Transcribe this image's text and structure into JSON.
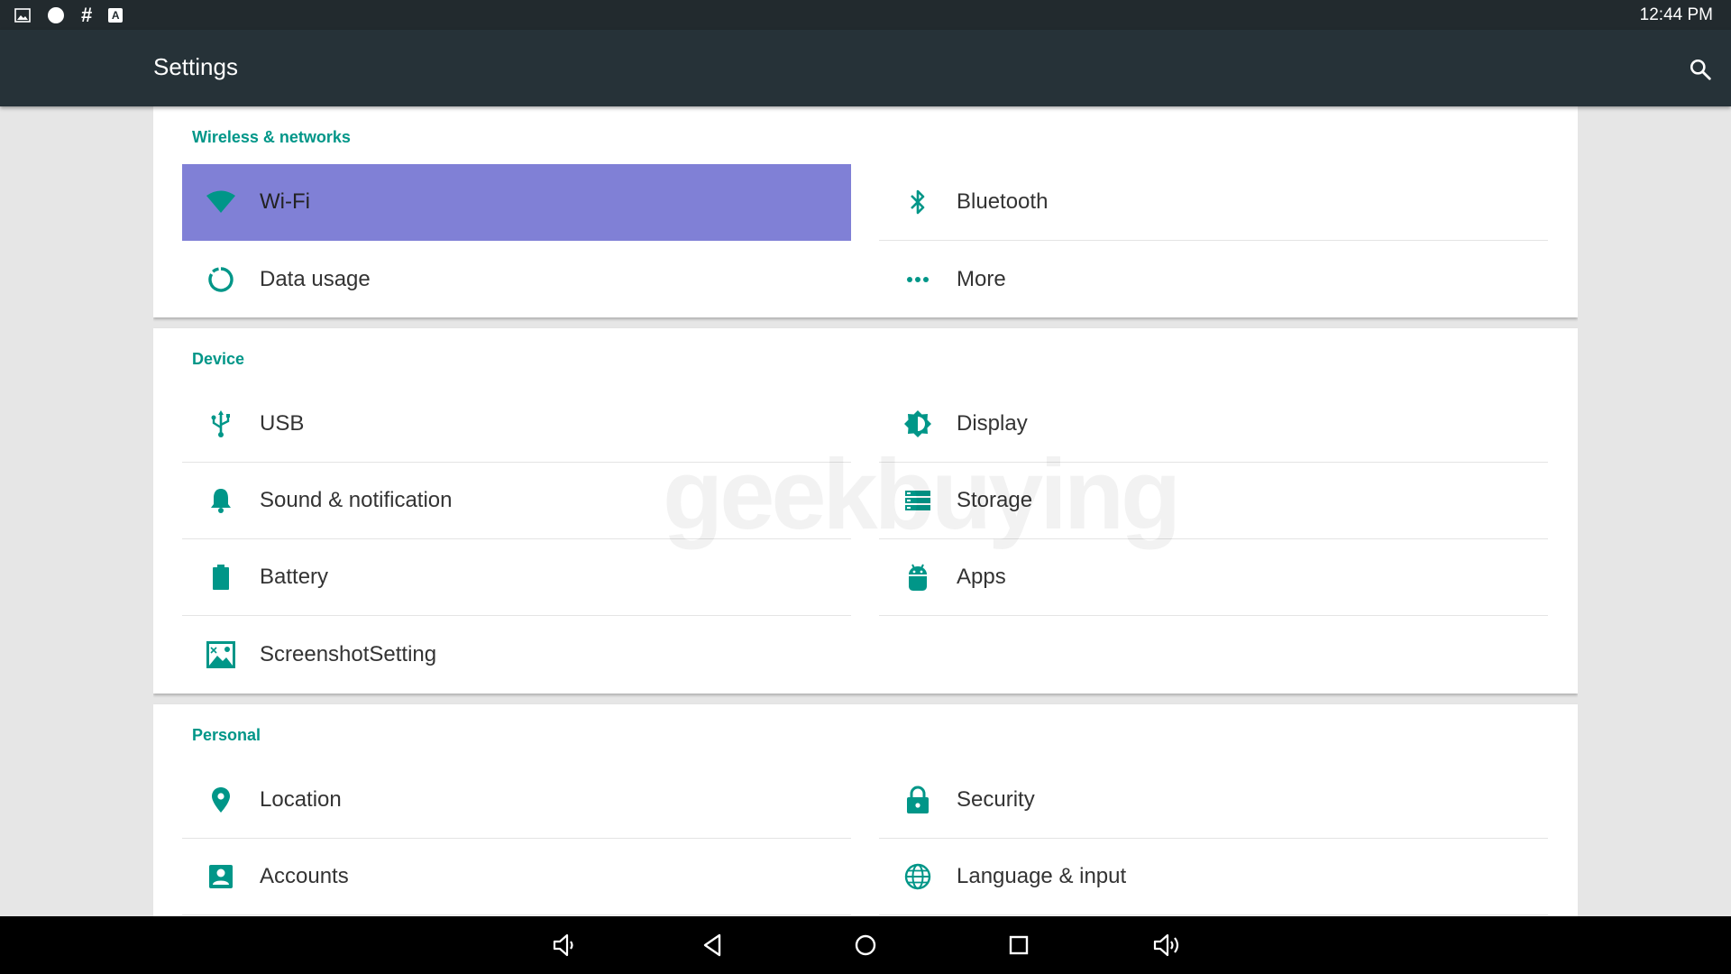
{
  "status_bar": {
    "time": "12:44 PM",
    "hash_glyph": "#",
    "a_glyph": "A"
  },
  "app_bar": {
    "title": "Settings"
  },
  "sections": [
    {
      "title": "Wireless & networks",
      "items": [
        {
          "label": "Wi-Fi",
          "icon": "wifi-icon",
          "selected": true
        },
        {
          "label": "Bluetooth",
          "icon": "bluetooth-icon"
        },
        {
          "label": "Data usage",
          "icon": "data-usage-icon"
        },
        {
          "label": "More",
          "icon": "more-icon"
        }
      ]
    },
    {
      "title": "Device",
      "items": [
        {
          "label": "USB",
          "icon": "usb-icon"
        },
        {
          "label": "Display",
          "icon": "display-brightness-icon"
        },
        {
          "label": "Sound & notification",
          "icon": "bell-icon"
        },
        {
          "label": "Storage",
          "icon": "storage-icon"
        },
        {
          "label": "Battery",
          "icon": "battery-icon"
        },
        {
          "label": "Apps",
          "icon": "android-icon"
        },
        {
          "label": "ScreenshotSetting",
          "icon": "screenshot-icon"
        }
      ]
    },
    {
      "title": "Personal",
      "items": [
        {
          "label": "Location",
          "icon": "location-pin-icon"
        },
        {
          "label": "Security",
          "icon": "lock-icon"
        },
        {
          "label": "Accounts",
          "icon": "account-box-icon"
        },
        {
          "label": "Language & input",
          "icon": "globe-icon"
        }
      ]
    }
  ],
  "watermark": "geekbuying",
  "colors": {
    "accent": "#009688",
    "app_bar": "#263238",
    "status_bar": "#222a2e",
    "selected": "#8080d6",
    "background": "#e6e6e6"
  }
}
